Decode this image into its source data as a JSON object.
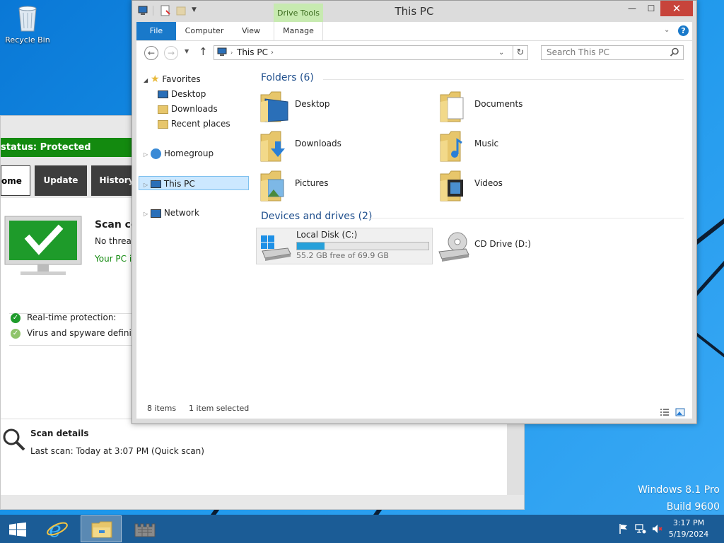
{
  "desktop": {
    "recycle_bin": "Recycle Bin",
    "watermark_line1": "Windows 8.1 Pro",
    "watermark_line2": "Build 9600"
  },
  "defender": {
    "status": "status: Protected",
    "tabs": [
      "ome",
      "Update",
      "History"
    ],
    "scan_title": "Scan co",
    "no_threats": "No threats",
    "your_pc": "Your PC is",
    "realtime": "Real-time protection:",
    "virus_defs": "Virus and spyware definition",
    "scan_details": "Scan details",
    "last_scan": "Last scan:  Today at 3:07 PM (Quick scan)"
  },
  "explorer": {
    "title": "This PC",
    "drive_tools": "Drive Tools",
    "window_buttons": {
      "minimize": "—",
      "maximize": "☐",
      "close": "✕"
    },
    "ribbon_tabs": {
      "file": "File",
      "computer": "Computer",
      "view": "View",
      "manage": "Manage"
    },
    "address": "This PC",
    "search_placeholder": "Search This PC",
    "nav": {
      "favorites": "Favorites",
      "desktop": "Desktop",
      "downloads": "Downloads",
      "recent": "Recent places",
      "homegroup": "Homegroup",
      "this_pc": "This PC",
      "network": "Network"
    },
    "folders_header": "Folders (6)",
    "folders": [
      "Desktop",
      "Documents",
      "Downloads",
      "Music",
      "Pictures",
      "Videos"
    ],
    "devices_header": "Devices and drives (2)",
    "local_disk": {
      "name": "Local Disk (C:)",
      "free": "55.2 GB free of 69.9 GB",
      "used_fraction": 0.21
    },
    "cd_drive": "CD Drive (D:)",
    "status_items": "8 items",
    "status_selected": "1 item selected"
  },
  "taskbar": {
    "time": "3:17 PM",
    "date": "5/19/2024"
  },
  "colors": {
    "accent": "#1979ca",
    "protected_green": "#138a0f",
    "selection": "#cce8ff",
    "drive_bar": "#26a0da",
    "close_red": "#c7443b"
  }
}
